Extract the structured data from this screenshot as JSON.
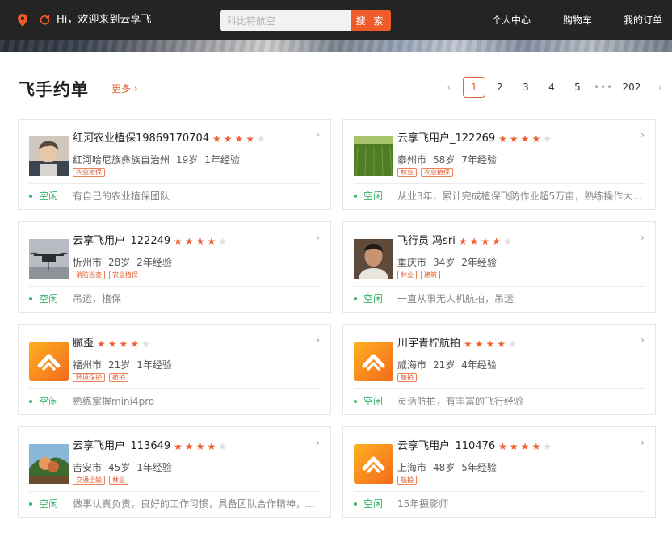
{
  "header": {
    "greeting": "Hi，欢迎来到云享飞",
    "search_placeholder": "科比特航空",
    "search_button": "搜 索",
    "nav": [
      "个人中心",
      "购物车",
      "我的订单"
    ],
    "icons": [
      "location-pin-icon",
      "refresh-icon"
    ],
    "accent_color": "#ef5b2b",
    "bg_color": "#242424"
  },
  "section": {
    "title": "飞手约单",
    "more": "更多 ›"
  },
  "pagination": {
    "prev": "‹",
    "pages": [
      "1",
      "2",
      "3",
      "4",
      "5"
    ],
    "current": "1",
    "dots": "•••",
    "last": "202",
    "next": "›"
  },
  "pilots": [
    {
      "name": "红河农业植保19869170704",
      "rating": 4,
      "city": "红河哈尼族彝族自治州",
      "age": "19岁",
      "exp": "1年经验",
      "tags": [
        "农业植保"
      ],
      "status": "空闲",
      "desc": "有自己的农业植保团队",
      "avatar": "photo-child"
    },
    {
      "name": "云享飞用户_122269",
      "rating": 4,
      "city": "泰州市",
      "age": "58岁",
      "exp": "7年经验",
      "tags": [
        "林业",
        "农业植保"
      ],
      "status": "空闲",
      "desc": "从业3年，累计完成植保飞防作业超5万亩，熟练操作大疆T...",
      "avatar": "photo-field"
    },
    {
      "name": "云享飞用户_122249",
      "rating": 4,
      "city": "忻州市",
      "age": "28岁",
      "exp": "2年经验",
      "tags": [
        "消防巡查",
        "农业植保"
      ],
      "status": "空闲",
      "desc": "吊运，植保",
      "avatar": "photo-drone"
    },
    {
      "name": "飞行员 冯sri",
      "rating": 4,
      "city": "重庆市",
      "age": "34岁",
      "exp": "2年经验",
      "tags": [
        "林业",
        "建筑"
      ],
      "status": "空闲",
      "desc": "一直从事无人机航拍，吊运",
      "avatar": "photo-man"
    },
    {
      "name": "腻歪",
      "rating": 4,
      "city": "福州市",
      "age": "21岁",
      "exp": "1年经验",
      "tags": [
        "环境保护",
        "航拍"
      ],
      "status": "空闲",
      "desc": "熟练掌握mini4pro",
      "avatar": "logo"
    },
    {
      "name": "川宇青柠航拍",
      "rating": 4,
      "city": "威海市",
      "age": "21岁",
      "exp": "4年经验",
      "tags": [
        "航拍"
      ],
      "status": "空闲",
      "desc": "灵活航拍，有丰富的飞行经验",
      "avatar": "logo"
    },
    {
      "name": "云享飞用户_113649",
      "rating": 4,
      "city": "吉安市",
      "age": "45岁",
      "exp": "1年经验",
      "tags": [
        "交通运输",
        "林业"
      ],
      "status": "空闲",
      "desc": "做事认真负责，良好的工作习惯，具备团队合作精神，具...",
      "avatar": "photo-tree"
    },
    {
      "name": "云享飞用户_110476",
      "rating": 4,
      "city": "上海市",
      "age": "48岁",
      "exp": "5年经验",
      "tags": [
        "航拍"
      ],
      "status": "空闲",
      "desc": "15年摄影师",
      "avatar": "logo"
    }
  ]
}
